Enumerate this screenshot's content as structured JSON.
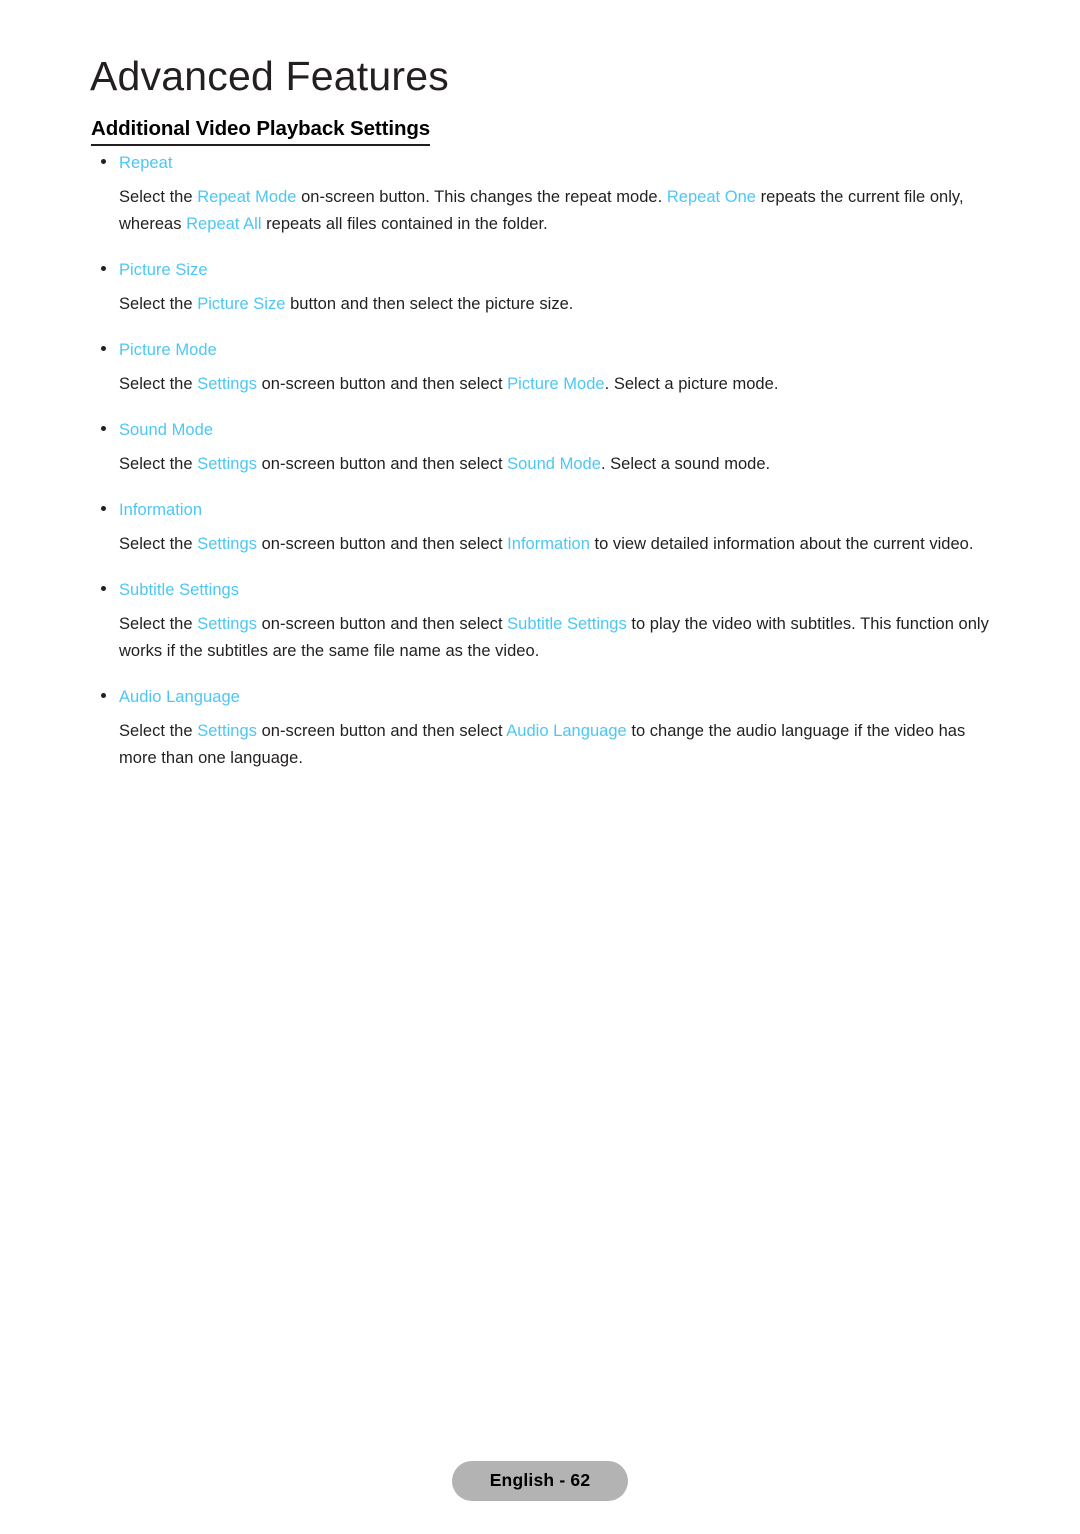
{
  "document": {
    "chapter_title": "Advanced Features",
    "section_heading": "Additional Video Playback Settings",
    "accent_color": "#4cc7f5",
    "text_color": "#231f20",
    "footer_badge_color": "#b3b3b3"
  },
  "entries": [
    {
      "label": "Repeat",
      "paragraph": [
        {
          "text": "Select the ",
          "highlight": false
        },
        {
          "text": "Repeat Mode",
          "highlight": true
        },
        {
          "text": " on-screen button. This changes the repeat mode. ",
          "highlight": false
        },
        {
          "text": "Repeat One",
          "highlight": true
        },
        {
          "text": " repeats the current file only, whereas ",
          "highlight": false
        },
        {
          "text": "Repeat All",
          "highlight": true
        },
        {
          "text": " repeats all files contained in the folder.",
          "highlight": false
        }
      ]
    },
    {
      "label": "Picture Size",
      "paragraph": [
        {
          "text": "Select the ",
          "highlight": false
        },
        {
          "text": "Picture Size",
          "highlight": true
        },
        {
          "text": " button and then select the picture size.",
          "highlight": false
        }
      ]
    },
    {
      "label": "Picture Mode",
      "paragraph": [
        {
          "text": "Select the ",
          "highlight": false
        },
        {
          "text": "Settings",
          "highlight": true
        },
        {
          "text": " on-screen button and then select ",
          "highlight": false
        },
        {
          "text": "Picture Mode",
          "highlight": true
        },
        {
          "text": ". Select a picture mode.",
          "highlight": false
        }
      ]
    },
    {
      "label": "Sound Mode",
      "paragraph": [
        {
          "text": "Select the ",
          "highlight": false
        },
        {
          "text": "Settings",
          "highlight": true
        },
        {
          "text": " on-screen button and then select ",
          "highlight": false
        },
        {
          "text": "Sound Mode",
          "highlight": true
        },
        {
          "text": ". Select a sound mode.",
          "highlight": false
        }
      ]
    },
    {
      "label": "Information",
      "paragraph": [
        {
          "text": "Select the ",
          "highlight": false
        },
        {
          "text": "Settings",
          "highlight": true
        },
        {
          "text": " on-screen button and then select ",
          "highlight": false
        },
        {
          "text": "Information",
          "highlight": true
        },
        {
          "text": " to view detailed information about the current video.",
          "highlight": false
        }
      ]
    },
    {
      "label": "Subtitle Settings",
      "paragraph": [
        {
          "text": "Select the ",
          "highlight": false
        },
        {
          "text": "Settings",
          "highlight": true
        },
        {
          "text": " on-screen button and then select ",
          "highlight": false
        },
        {
          "text": "Subtitle Settings",
          "highlight": true
        },
        {
          "text": " to play the video with subtitles. This function only works if the subtitles are the same file name as the video.",
          "highlight": false
        }
      ]
    },
    {
      "label": "Audio Language",
      "paragraph": [
        {
          "text": "Select the ",
          "highlight": false
        },
        {
          "text": "Settings",
          "highlight": true
        },
        {
          "text": " on-screen button and then select ",
          "highlight": false
        },
        {
          "text": "Audio Language",
          "highlight": true
        },
        {
          "text": " to change the audio language if the video has more than one language.",
          "highlight": false
        }
      ]
    }
  ],
  "footer": {
    "page_label": "English - 62"
  }
}
